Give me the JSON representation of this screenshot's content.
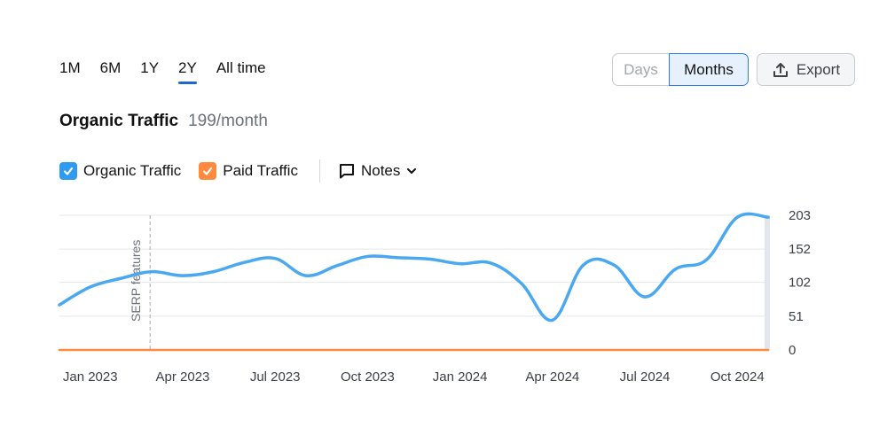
{
  "range_tabs": [
    "1M",
    "6M",
    "1Y",
    "2Y",
    "All time"
  ],
  "active_range": "2Y",
  "view_toggle": {
    "days": "Days",
    "months": "Months",
    "active": "Months"
  },
  "export_label": "Export",
  "header": {
    "title": "Organic Traffic",
    "value": "199/month"
  },
  "legend": {
    "organic": "Organic Traffic",
    "paid": "Paid Traffic",
    "notes": "Notes"
  },
  "colors": {
    "organic": "#4aa8f0",
    "paid": "#ff8a3d",
    "accent": "#1e66d0",
    "grid": "#e4e6ea"
  },
  "chart_data": {
    "type": "line",
    "x": [
      "2022-12",
      "2023-01",
      "2023-02",
      "2023-03",
      "2023-04",
      "2023-05",
      "2023-06",
      "2023-07",
      "2023-08",
      "2023-09",
      "2023-10",
      "2023-11",
      "2023-12",
      "2024-01",
      "2024-02",
      "2024-03",
      "2024-04",
      "2024-05",
      "2024-06",
      "2024-07",
      "2024-08",
      "2024-09",
      "2024-10",
      "2024-11"
    ],
    "x_ticks": [
      "Jan 2023",
      "Apr 2023",
      "Jul 2023",
      "Oct 2023",
      "Jan 2024",
      "Apr 2024",
      "Jul 2024",
      "Oct 2024"
    ],
    "y_ticks": [
      0,
      51,
      102,
      152,
      203
    ],
    "ylim": [
      0,
      203
    ],
    "grid": true,
    "series": [
      {
        "name": "Organic Traffic",
        "values": [
          68,
          95,
          108,
          118,
          112,
          118,
          132,
          138,
          112,
          127,
          141,
          139,
          137,
          130,
          131,
          100,
          45,
          128,
          128,
          80,
          122,
          136,
          200,
          200
        ]
      },
      {
        "name": "Paid Traffic",
        "values": [
          0,
          0,
          0,
          0,
          0,
          0,
          0,
          0,
          0,
          0,
          0,
          0,
          0,
          0,
          0,
          0,
          0,
          0,
          0,
          0,
          0,
          0,
          0,
          0
        ]
      }
    ],
    "annotations": [
      {
        "x": "2023-03",
        "label": "SERP features"
      }
    ]
  }
}
